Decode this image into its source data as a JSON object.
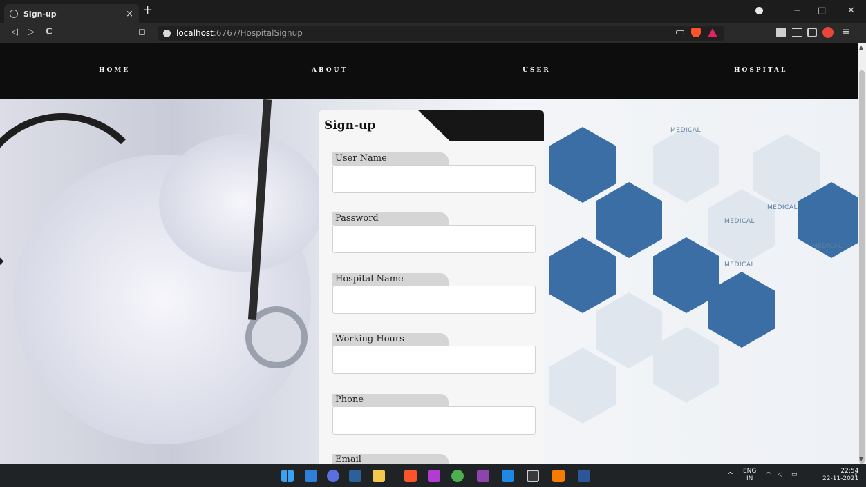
{
  "browser": {
    "tab_title": "Sign-up",
    "tab_close": "×",
    "new_tab": "+",
    "url_host": "localhost",
    "url_path": ":6767/HospitalSignup",
    "back": "◁",
    "forward": "▷",
    "reload": "C",
    "bookmark": "◻",
    "minimize": "−",
    "maximize": "□",
    "close": "✕",
    "menu": "≡"
  },
  "site_nav": {
    "items": [
      {
        "label": "HOME"
      },
      {
        "label": "ABOUT"
      },
      {
        "label": "USER"
      },
      {
        "label": "HOSPITAL"
      }
    ]
  },
  "hero": {
    "hex_labels": [
      "MEDICAL",
      "MEDICAL",
      "MEDICAL",
      "MEDICAL",
      "MEDICAL"
    ]
  },
  "form": {
    "title": "Sign-up",
    "fields": [
      {
        "label": "User Name",
        "value": ""
      },
      {
        "label": "Password",
        "value": ""
      },
      {
        "label": "Hospital Name",
        "value": ""
      },
      {
        "label": "Working Hours",
        "value": ""
      },
      {
        "label": "Phone",
        "value": ""
      },
      {
        "label": "Email",
        "value": ""
      }
    ]
  },
  "taskbar": {
    "language_top": "ENG",
    "language_bottom": "IN",
    "time": "22:54",
    "date": "22-11-2021",
    "tray_arrow": "^"
  },
  "colors": {
    "nav_bg": "#0d0d0d",
    "card_bg": "#f6f6f6",
    "label_bg": "#d5d5d5",
    "hex_blue": "#3a6ea5",
    "taskbar_bg": "#202326"
  }
}
